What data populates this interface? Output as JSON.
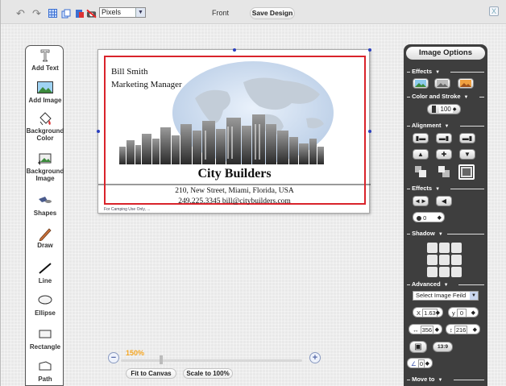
{
  "toolbar": {
    "units": "Pixels",
    "side": "Front",
    "save_label": "Save Design",
    "close": "X",
    "icons": [
      "undo-icon",
      "redo-icon",
      "grid-icon",
      "copy-icon",
      "paste-icon",
      "delete-icon"
    ]
  },
  "tools": [
    {
      "label": "Add Text",
      "icon": "text-t-icon"
    },
    {
      "label": "Add Image",
      "icon": "image-icon"
    },
    {
      "label": "Background Color",
      "icon": "paint-bucket-icon"
    },
    {
      "label": "Background Image",
      "icon": "background-image-icon"
    },
    {
      "label": "Shapes",
      "icon": "shapes-icon"
    },
    {
      "label": "Draw",
      "icon": "pencil-icon"
    },
    {
      "label": "Line",
      "icon": "line-icon"
    },
    {
      "label": "Ellipse",
      "icon": "ellipse-icon"
    },
    {
      "label": "Rectangle",
      "icon": "rectangle-icon"
    },
    {
      "label": "Path",
      "icon": "path-icon"
    }
  ],
  "card": {
    "name": "Bill Smith",
    "title": "Marketing Manager",
    "company": "City Builders",
    "address": "210, New Street, Miami, Florida, USA",
    "contact": "249.225.3345  bill@citybuilders.com",
    "note": "For Camping Use Only, ..."
  },
  "zoom": {
    "percent": "150%",
    "fit_label": "Fit to Canvas",
    "scale_label": "Scale to 100%",
    "level": 1.5
  },
  "image_options": {
    "title": "Image Options",
    "sections": {
      "effects": "Effects",
      "color_stroke": "Color and Stroke",
      "alignment": "Alignment",
      "effects2": "Effects",
      "shadow": "Shadow",
      "advanced": "Advanced",
      "move_to": "Move to"
    },
    "stroke_value": "100",
    "effect_value": "0",
    "select_field": "Select Image Feild",
    "x_value": "1.63",
    "y_value": "0",
    "width_value": "356",
    "height_value": "216",
    "lock_label": "13:9",
    "rotate_value": "0",
    "x_label": "X",
    "y_label": "y"
  }
}
